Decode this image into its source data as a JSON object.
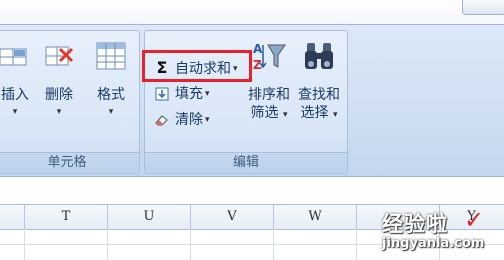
{
  "ribbon": {
    "cells_group": {
      "label": "单元格",
      "insert_label": "插入",
      "delete_label": "删除",
      "format_label": "格式",
      "dropdown_glyph": "▾"
    },
    "editing_group": {
      "label": "编辑",
      "autosum_symbol": "Σ",
      "autosum_label": "自动求和",
      "fill_label": "填充",
      "clear_label": "清除",
      "sort_label_line1": "排序和",
      "sort_label_line2": "筛选",
      "find_label_line1": "查找和",
      "find_label_line2": "选择",
      "dropdown_glyph": "▾"
    }
  },
  "columns": [
    "T",
    "U",
    "V",
    "W",
    "Y"
  ],
  "watermark": {
    "text": "经验啦",
    "check": "✓",
    "site": "jingyanla.com"
  },
  "colors": {
    "highlight": "#e8212a",
    "ribbon_bg": "#d7e5f6",
    "label_text": "#1b3a66"
  }
}
